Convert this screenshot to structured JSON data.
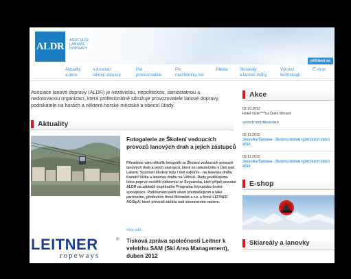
{
  "header": {
    "logo_text": "ALDR",
    "org_lines": [
      "ASOCIACE",
      "LANOVÉ",
      "DOPRAVY"
    ],
    "login_label": "přihlásit se"
  },
  "nav": {
    "items": [
      {
        "line1": "Aktuality",
        "line2": "a akce"
      },
      {
        "line1": "o Asociaci",
        "line2": "lanové dopravy"
      },
      {
        "line1": "Pro",
        "line2": "provozovatele"
      },
      {
        "line1": "Pro",
        "line2": "návštěvníky hor"
      },
      {
        "line1": "Média",
        "line2": ""
      },
      {
        "line1": "Skiareály",
        "line2": "a lanové dráhy"
      },
      {
        "line1": "Výrobci",
        "line2": "technologií"
      },
      {
        "line1": "E-shop",
        "line2": ""
      }
    ]
  },
  "intro": "Asociace lanové dopravy (ALDR) je nezávislou, nepolitickou, samostatnou a nedotovanou organizací, která profesionálně sdružuje provozovatele lanové dopravy, podnikatele na horách a některé horské městské a obecní úřady.",
  "sections": {
    "news": "Aktuality",
    "events": "Akce",
    "eshop": "E-shop",
    "resorts": "Skiareály a lanovky"
  },
  "news": [
    {
      "title": "Fotogalerie ze Školení vedoucích provozů lanových drah a jejich zástupců",
      "body": "Přinášíme vám několik fotografií ze Školení vedoucích provozů lanových drah a jejich zástupců, které se uskutečnilo v Ústí nad Labem. Součástí školení byly i dvě exkurze - na lanovou dráhu Komáří Vížka a lanovou dráhu na Větruši. Rády poděkujeme letos poprvé rozšířili odborníci ze Švýcarska, kteří přijali pozvání ALDR na základě úspěšného Programu švýcarsko-české spolupráce. Poděkování patří všem přednášejícím a také partnerům, především firmě Michálek s.r.o. a firmě LEITNER AG/SpA, které převzali záštitu nad slavnostním rautem.",
      "more": "Více zde..."
    },
    {
      "title": "Tisková zpráva společnosti Leitner k veletrhu SAM (Ski Area Management), duben 2012"
    }
  ],
  "leitner": {
    "word": "LEITNER",
    "sub": "ropeways",
    "mark": "®"
  },
  "events": [
    {
      "date": "02.10.2012",
      "text": "Hotel Vista****na Dolní Moravě",
      "link": "veletrh InterMountain"
    },
    {
      "date": "02.11.2012",
      "link": "Jeseníky/Šumava - školení obsluh lyžařských vleků 2012"
    },
    {
      "date": "03.11.2012",
      "link": "Jeseníky/Šumava - školení obsluh lyžařských vleků 2012"
    }
  ],
  "colors": {
    "accent_red": "#d51a1a",
    "link_blue": "#3a8fd3",
    "logo_blue": "#1a7ec2",
    "leitner_blue": "#1f3e8e"
  }
}
